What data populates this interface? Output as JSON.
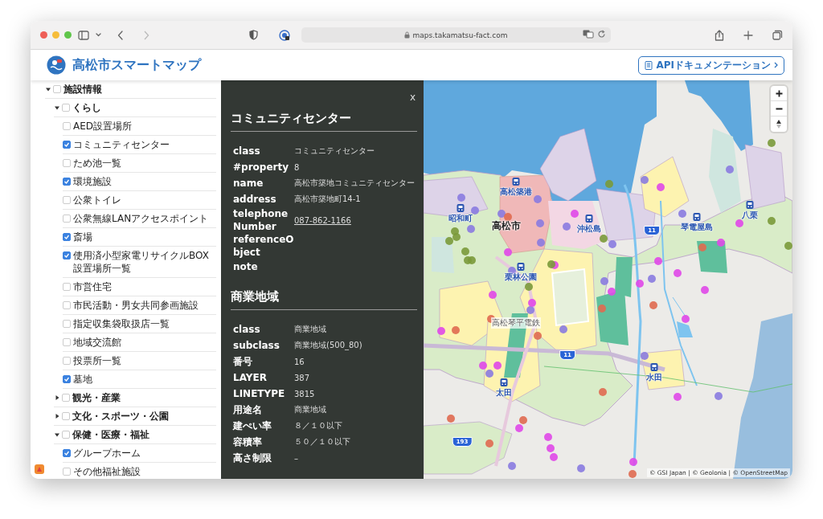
{
  "browser": {
    "url": "maps.takamatsu-fact.com"
  },
  "header": {
    "title": "高松市スマートマップ",
    "api_button": "APIドキュメンテーション"
  },
  "sidebar": {
    "tree": [
      {
        "label": "施設情報",
        "checked": false,
        "expanded": true,
        "children": [
          {
            "label": "くらし",
            "checked": false,
            "expanded": true,
            "children": [
              {
                "label": "AED設置場所",
                "checked": false
              },
              {
                "label": "コミュニティセンター",
                "checked": true
              },
              {
                "label": "ため池一覧",
                "checked": false
              },
              {
                "label": "環境施設",
                "checked": true
              },
              {
                "label": "公衆トイレ",
                "checked": false
              },
              {
                "label": "公衆無線LANアクセスポイント",
                "checked": false
              },
              {
                "label": "斎場",
                "checked": true
              },
              {
                "label": "使用済小型家電リサイクルBOX設置場所一覧",
                "checked": true
              },
              {
                "label": "市営住宅",
                "checked": false
              },
              {
                "label": "市民活動・男女共同参画施設",
                "checked": false
              },
              {
                "label": "指定収集袋取扱店一覧",
                "checked": false
              },
              {
                "label": "地域交流館",
                "checked": false
              },
              {
                "label": "投票所一覧",
                "checked": false
              },
              {
                "label": "墓地",
                "checked": true
              }
            ]
          },
          {
            "label": "観光・産業",
            "checked": false,
            "expanded": false
          },
          {
            "label": "文化・スポーツ・公園",
            "checked": false,
            "expanded": false
          },
          {
            "label": "保健・医療・福祉",
            "checked": false,
            "expanded": true,
            "children": [
              {
                "label": "グループホーム",
                "checked": true
              },
              {
                "label": "その他福祉施設",
                "checked": false
              }
            ]
          }
        ]
      }
    ]
  },
  "popup": {
    "close": "x",
    "sections": [
      {
        "title": "コミュニティセンター",
        "properties": [
          {
            "key": "class",
            "value": "コミュニティセンター",
            "kind": "text"
          },
          {
            "key": "#property",
            "value": "8",
            "kind": "text"
          },
          {
            "key": "name",
            "value": "高松市築地コミュニティセンター",
            "kind": "text"
          },
          {
            "key": "address",
            "value": "高松市築地町14-1",
            "kind": "text"
          },
          {
            "key": "telephoneNumber",
            "value": "087-862-1166",
            "kind": "link"
          },
          {
            "key": "referenceObject",
            "kind": "text"
          },
          {
            "key": "note",
            "kind": "text"
          }
        ]
      },
      {
        "title": "商業地域",
        "properties": [
          {
            "key": "class",
            "value": "商業地域",
            "kind": "text"
          },
          {
            "key": "subclass",
            "value": "商業地域(500_80)",
            "kind": "text"
          },
          {
            "key": "番号",
            "value": "16",
            "kind": "text"
          },
          {
            "key": "LAYER",
            "value": "387",
            "kind": "text"
          },
          {
            "key": "LINETYPE",
            "value": "3815",
            "kind": "text"
          },
          {
            "key": "用途名",
            "value": "商業地域",
            "kind": "text"
          },
          {
            "key": "建ぺい率",
            "value": "８／１０以下",
            "kind": "text"
          },
          {
            "key": "容積率",
            "value": "５０／１０以下",
            "kind": "text"
          },
          {
            "key": "高さ制限",
            "value": "–",
            "kind": "text"
          }
        ]
      }
    ]
  },
  "map": {
    "labels": [
      {
        "text": "高松築港",
        "kind": "station"
      },
      {
        "text": "昭和町",
        "kind": "station"
      },
      {
        "text": "高松市",
        "kind": "city"
      },
      {
        "text": "沖松島",
        "kind": "station"
      },
      {
        "text": "琴電屋島",
        "kind": "station"
      },
      {
        "text": "八栗",
        "kind": "station"
      },
      {
        "text": "栗林公園",
        "kind": "station"
      },
      {
        "text": "高松琴平電鉄",
        "kind": "railway"
      },
      {
        "text": "水田",
        "kind": "station"
      },
      {
        "text": "太田",
        "kind": "station"
      }
    ],
    "route_shields": [
      "11",
      "11",
      "193"
    ],
    "attribution": "© GSI Japan | © Geolonia | © OpenStreetMap"
  }
}
